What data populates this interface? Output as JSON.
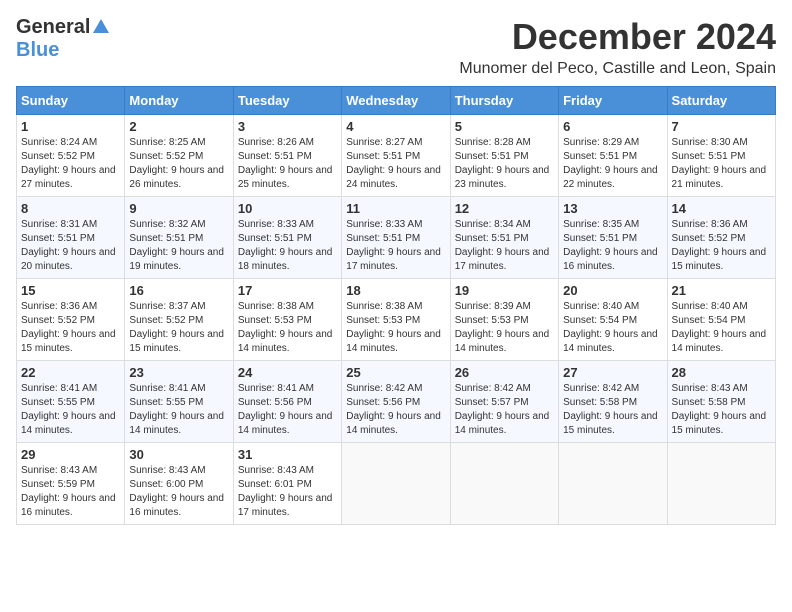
{
  "header": {
    "logo_general": "General",
    "logo_blue": "Blue",
    "month_title": "December 2024",
    "location": "Munomer del Peco, Castille and Leon, Spain"
  },
  "weekdays": [
    "Sunday",
    "Monday",
    "Tuesday",
    "Wednesday",
    "Thursday",
    "Friday",
    "Saturday"
  ],
  "weeks": [
    [
      {
        "day": "1",
        "sunrise": "8:24 AM",
        "sunset": "5:52 PM",
        "daylight": "9 hours and 27 minutes."
      },
      {
        "day": "2",
        "sunrise": "8:25 AM",
        "sunset": "5:52 PM",
        "daylight": "9 hours and 26 minutes."
      },
      {
        "day": "3",
        "sunrise": "8:26 AM",
        "sunset": "5:51 PM",
        "daylight": "9 hours and 25 minutes."
      },
      {
        "day": "4",
        "sunrise": "8:27 AM",
        "sunset": "5:51 PM",
        "daylight": "9 hours and 24 minutes."
      },
      {
        "day": "5",
        "sunrise": "8:28 AM",
        "sunset": "5:51 PM",
        "daylight": "9 hours and 23 minutes."
      },
      {
        "day": "6",
        "sunrise": "8:29 AM",
        "sunset": "5:51 PM",
        "daylight": "9 hours and 22 minutes."
      },
      {
        "day": "7",
        "sunrise": "8:30 AM",
        "sunset": "5:51 PM",
        "daylight": "9 hours and 21 minutes."
      }
    ],
    [
      {
        "day": "8",
        "sunrise": "8:31 AM",
        "sunset": "5:51 PM",
        "daylight": "9 hours and 20 minutes."
      },
      {
        "day": "9",
        "sunrise": "8:32 AM",
        "sunset": "5:51 PM",
        "daylight": "9 hours and 19 minutes."
      },
      {
        "day": "10",
        "sunrise": "8:33 AM",
        "sunset": "5:51 PM",
        "daylight": "9 hours and 18 minutes."
      },
      {
        "day": "11",
        "sunrise": "8:33 AM",
        "sunset": "5:51 PM",
        "daylight": "9 hours and 17 minutes."
      },
      {
        "day": "12",
        "sunrise": "8:34 AM",
        "sunset": "5:51 PM",
        "daylight": "9 hours and 17 minutes."
      },
      {
        "day": "13",
        "sunrise": "8:35 AM",
        "sunset": "5:51 PM",
        "daylight": "9 hours and 16 minutes."
      },
      {
        "day": "14",
        "sunrise": "8:36 AM",
        "sunset": "5:52 PM",
        "daylight": "9 hours and 15 minutes."
      }
    ],
    [
      {
        "day": "15",
        "sunrise": "8:36 AM",
        "sunset": "5:52 PM",
        "daylight": "9 hours and 15 minutes."
      },
      {
        "day": "16",
        "sunrise": "8:37 AM",
        "sunset": "5:52 PM",
        "daylight": "9 hours and 15 minutes."
      },
      {
        "day": "17",
        "sunrise": "8:38 AM",
        "sunset": "5:53 PM",
        "daylight": "9 hours and 14 minutes."
      },
      {
        "day": "18",
        "sunrise": "8:38 AM",
        "sunset": "5:53 PM",
        "daylight": "9 hours and 14 minutes."
      },
      {
        "day": "19",
        "sunrise": "8:39 AM",
        "sunset": "5:53 PM",
        "daylight": "9 hours and 14 minutes."
      },
      {
        "day": "20",
        "sunrise": "8:40 AM",
        "sunset": "5:54 PM",
        "daylight": "9 hours and 14 minutes."
      },
      {
        "day": "21",
        "sunrise": "8:40 AM",
        "sunset": "5:54 PM",
        "daylight": "9 hours and 14 minutes."
      }
    ],
    [
      {
        "day": "22",
        "sunrise": "8:41 AM",
        "sunset": "5:55 PM",
        "daylight": "9 hours and 14 minutes."
      },
      {
        "day": "23",
        "sunrise": "8:41 AM",
        "sunset": "5:55 PM",
        "daylight": "9 hours and 14 minutes."
      },
      {
        "day": "24",
        "sunrise": "8:41 AM",
        "sunset": "5:56 PM",
        "daylight": "9 hours and 14 minutes."
      },
      {
        "day": "25",
        "sunrise": "8:42 AM",
        "sunset": "5:56 PM",
        "daylight": "9 hours and 14 minutes."
      },
      {
        "day": "26",
        "sunrise": "8:42 AM",
        "sunset": "5:57 PM",
        "daylight": "9 hours and 14 minutes."
      },
      {
        "day": "27",
        "sunrise": "8:42 AM",
        "sunset": "5:58 PM",
        "daylight": "9 hours and 15 minutes."
      },
      {
        "day": "28",
        "sunrise": "8:43 AM",
        "sunset": "5:58 PM",
        "daylight": "9 hours and 15 minutes."
      }
    ],
    [
      {
        "day": "29",
        "sunrise": "8:43 AM",
        "sunset": "5:59 PM",
        "daylight": "9 hours and 16 minutes."
      },
      {
        "day": "30",
        "sunrise": "8:43 AM",
        "sunset": "6:00 PM",
        "daylight": "9 hours and 16 minutes."
      },
      {
        "day": "31",
        "sunrise": "8:43 AM",
        "sunset": "6:01 PM",
        "daylight": "9 hours and 17 minutes."
      },
      null,
      null,
      null,
      null
    ]
  ]
}
